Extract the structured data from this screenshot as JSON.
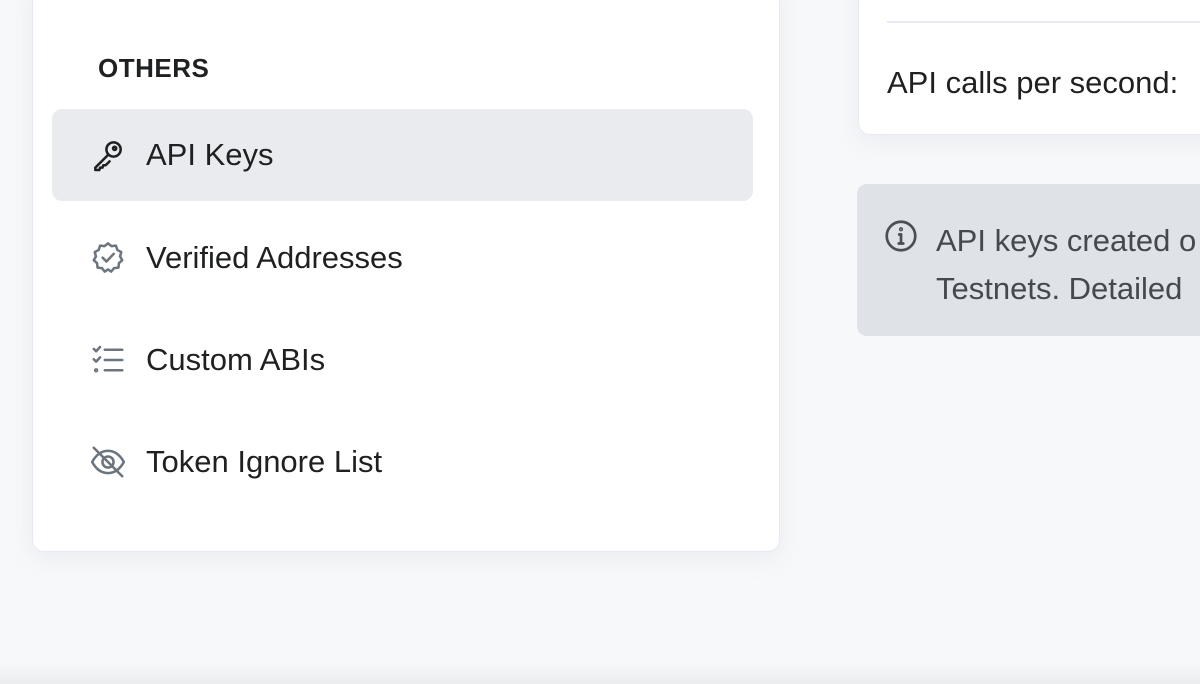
{
  "sidebar": {
    "section_title": "OTHERS",
    "items": [
      {
        "label": "API Keys",
        "icon": "key-icon",
        "active": true
      },
      {
        "label": "Verified Addresses",
        "icon": "verified-badge-icon",
        "active": false
      },
      {
        "label": "Custom ABIs",
        "icon": "checklist-icon",
        "active": false
      },
      {
        "label": "Token Ignore List",
        "icon": "eye-slash-icon",
        "active": false
      }
    ]
  },
  "stats": {
    "api_calls_label": "API calls per second:"
  },
  "info": {
    "icon": "info-icon",
    "line1": "API keys created o",
    "line2": "Testnets. Detailed"
  },
  "colors": {
    "active_item_bg": "#e9ebee",
    "info_bg": "#dfe2e6",
    "page_bg": "#f7f8fa"
  }
}
